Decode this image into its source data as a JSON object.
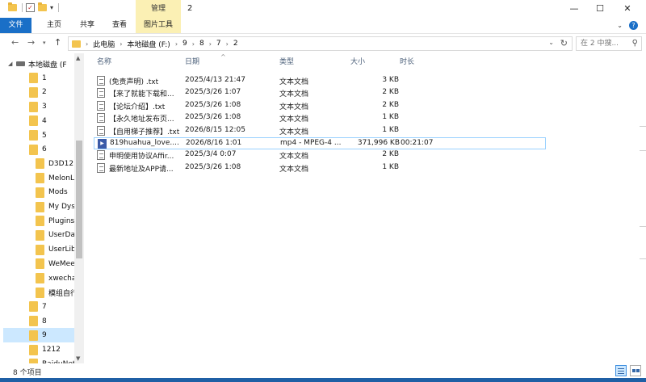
{
  "window": {
    "title": "2",
    "context_tab": "管理",
    "controls": {
      "minimize": "—",
      "maximize": "☐",
      "close": "✕"
    }
  },
  "ribbon": {
    "file_tab": "文件",
    "tabs": [
      "主页",
      "共享",
      "查看"
    ],
    "tools_tab": "图片工具",
    "accent": "#1a6fc7",
    "context_color": "#fbf0b4"
  },
  "address": {
    "crumbs": [
      "此电脑",
      "本地磁盘 (F:)",
      "9",
      "8",
      "7",
      "2"
    ],
    "search_placeholder": "在 2 中搜..."
  },
  "nav_tree": [
    {
      "label": "本地磁盘 (F",
      "kind": "drive",
      "level": 0
    },
    {
      "label": "1",
      "kind": "folder",
      "level": 1
    },
    {
      "label": "2",
      "kind": "folder",
      "level": 1
    },
    {
      "label": "3",
      "kind": "folder",
      "level": 1
    },
    {
      "label": "4",
      "kind": "folder",
      "level": 1
    },
    {
      "label": "5",
      "kind": "folder",
      "level": 1
    },
    {
      "label": "6",
      "kind": "folder",
      "level": 1
    },
    {
      "label": "D3D12",
      "kind": "folder",
      "level": 2
    },
    {
      "label": "MelonLc",
      "kind": "folder",
      "level": 2
    },
    {
      "label": "Mods",
      "kind": "folder",
      "level": 2
    },
    {
      "label": "My Dyst",
      "kind": "folder",
      "level": 2
    },
    {
      "label": "Plugins",
      "kind": "folder",
      "level": 2
    },
    {
      "label": "UserDat",
      "kind": "folder",
      "level": 2
    },
    {
      "label": "UserLibs",
      "kind": "folder",
      "level": 2
    },
    {
      "label": "WeMeet",
      "kind": "folder",
      "level": 2
    },
    {
      "label": "xwechat",
      "kind": "folder",
      "level": 2
    },
    {
      "label": "模组自行",
      "kind": "folder",
      "level": 2
    },
    {
      "label": "7",
      "kind": "folder",
      "level": 1
    },
    {
      "label": "8",
      "kind": "folder",
      "level": 1
    },
    {
      "label": "9",
      "kind": "folder",
      "level": 1,
      "selected": true
    },
    {
      "label": "1212",
      "kind": "folder",
      "level": 1
    },
    {
      "label": "BaiduNet",
      "kind": "folder",
      "level": 1
    }
  ],
  "columns": {
    "name": "名称",
    "date": "日期",
    "type": "类型",
    "size": "大小",
    "length": "时长"
  },
  "files": [
    {
      "name": "(免责声明) .txt",
      "date": "2025/4/13 21:47",
      "type": "文本文档",
      "size": "3 KB",
      "length": "",
      "icon": "txt"
    },
    {
      "name": "【来了就能下载和...",
      "date": "2025/3/26 1:07",
      "type": "文本文档",
      "size": "2 KB",
      "length": "",
      "icon": "txt"
    },
    {
      "name": "【论坛介绍】.txt",
      "date": "2025/3/26 1:08",
      "type": "文本文档",
      "size": "2 KB",
      "length": "",
      "icon": "txt"
    },
    {
      "name": "【永久地址发布页...",
      "date": "2025/3/26 1:08",
      "type": "文本文档",
      "size": "1 KB",
      "length": "",
      "icon": "txt"
    },
    {
      "name": "【自用梯子推荐】.txt",
      "date": "2026/8/15 12:05",
      "type": "文本文档",
      "size": "1 KB",
      "length": "",
      "icon": "txt"
    },
    {
      "name": "819huahua_love....",
      "date": "2026/8/16 1:01",
      "type": "mp4 - MPEG-4 ...",
      "size": "371,996 KB",
      "length": "00:21:07",
      "icon": "mp4",
      "highlighted": true
    },
    {
      "name": "申明使用协议Affir...",
      "date": "2025/3/4 0:07",
      "type": "文本文档",
      "size": "2 KB",
      "length": "",
      "icon": "txt"
    },
    {
      "name": "最新地址及APP请...",
      "date": "2025/3/26 1:08",
      "type": "文本文档",
      "size": "1 KB",
      "length": "",
      "icon": "txt"
    }
  ],
  "status": {
    "item_count": "8 个项目"
  }
}
